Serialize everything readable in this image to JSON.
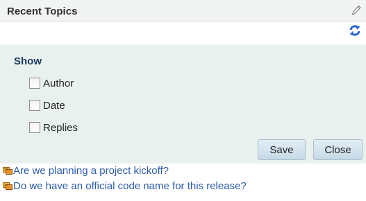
{
  "header": {
    "title": "Recent Topics",
    "edit_icon": "pencil-icon",
    "refresh_icon": "refresh-icon"
  },
  "show_panel": {
    "label": "Show",
    "options": [
      {
        "label": "Author",
        "checked": false
      },
      {
        "label": "Date",
        "checked": false
      },
      {
        "label": "Replies",
        "checked": false
      }
    ],
    "save_label": "Save",
    "close_label": "Close"
  },
  "topics": [
    {
      "title": "Are we planning a project kickoff?",
      "icon": "topic-icon"
    },
    {
      "title": "Do we have an official code name for this release?",
      "icon": "topic-icon"
    }
  ],
  "colors": {
    "header_bg": "#f1f4f2",
    "panel_bg": "#e9f1ef",
    "link": "#2b5bad",
    "refresh": "#2a66c8"
  }
}
